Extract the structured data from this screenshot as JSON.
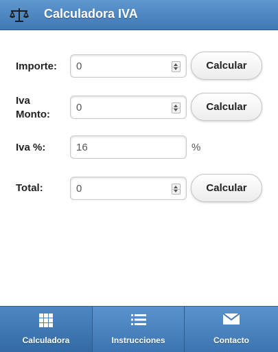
{
  "header": {
    "title": "Calculadora IVA",
    "icon": "scales-icon"
  },
  "form": {
    "importe": {
      "label": "Importe:",
      "value": "0",
      "button": "Calcular"
    },
    "iva_monto": {
      "label_line1": "Iva",
      "label_line2": "Monto:",
      "value": "0",
      "button": "Calcular"
    },
    "iva_pct": {
      "label": "Iva %:",
      "value": "16",
      "suffix": "%"
    },
    "total": {
      "label": "Total:",
      "value": "0",
      "button": "Calcular"
    }
  },
  "navbar": {
    "items": [
      {
        "label": "Calculadora",
        "icon": "grid-icon",
        "active": true
      },
      {
        "label": "Instrucciones",
        "icon": "list-icon",
        "active": false
      },
      {
        "label": "Contacto",
        "icon": "mail-icon",
        "active": false
      }
    ]
  },
  "colors": {
    "header": "#4a84c1",
    "navbar": "#4a84c1"
  }
}
